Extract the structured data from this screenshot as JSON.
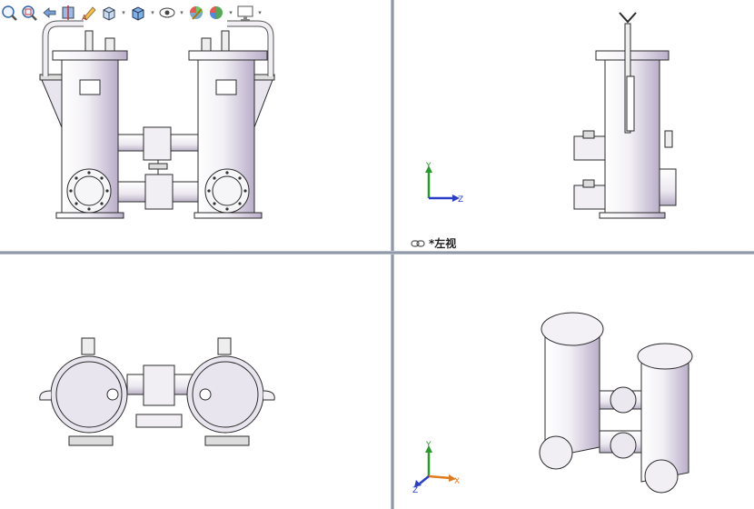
{
  "toolbar": {
    "items": [
      {
        "name": "zoom-to-fit-icon"
      },
      {
        "name": "zoom-to-area-icon"
      },
      {
        "name": "previous-view-icon"
      },
      {
        "name": "section-view-icon"
      },
      {
        "name": "dynamic-annotation-icon"
      },
      {
        "name": "view-orientation-icon",
        "has_dropdown": true
      },
      {
        "name": "display-style-icon",
        "has_dropdown": true
      },
      {
        "name": "hide-show-items-icon",
        "has_dropdown": true
      },
      {
        "name": "edit-appearance-icon"
      },
      {
        "name": "apply-scene-icon",
        "has_dropdown": true
      },
      {
        "name": "view-settings-icon",
        "has_dropdown": true
      }
    ]
  },
  "viewports": {
    "top_right": {
      "label": "*左视",
      "link_icon": "link-chain-icon",
      "triad": {
        "y": "Y",
        "z": "Z"
      }
    },
    "bottom_right": {
      "triad": {
        "y": "Y",
        "x": "X",
        "z": "Z"
      }
    }
  },
  "colors": {
    "divider": "#7d8796",
    "axis_x": "#e07a1f",
    "axis_y": "#2a9a2a",
    "axis_z": "#2a3fc8",
    "metal_light": "#f4f4f7",
    "metal_shade": "#cbc4d4",
    "edge": "#2b2b2b"
  }
}
